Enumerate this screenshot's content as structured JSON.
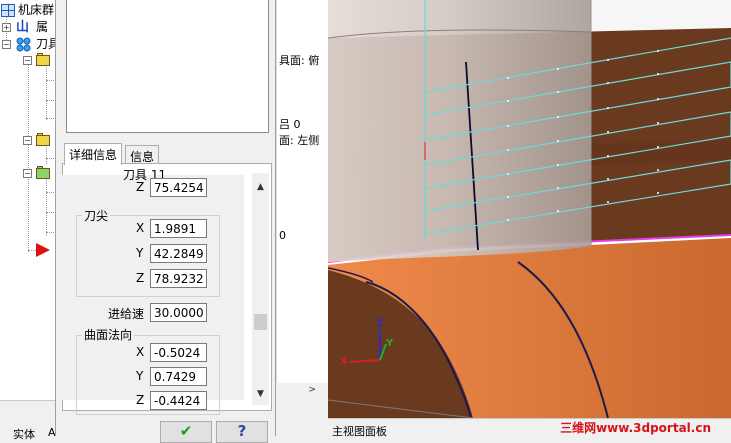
{
  "tree": {
    "items": [
      {
        "label": "机床群"
      },
      {
        "label": "属"
      },
      {
        "label": "刀具"
      }
    ]
  },
  "bottom_tabs": [
    "实体",
    "A"
  ],
  "mid_panel": {
    "lines": [
      "具面: 俯",
      "吕 0",
      "面: 左侧",
      "0"
    ]
  },
  "dialog": {
    "tabs": [
      "详细信息",
      "信息"
    ],
    "tool_label": "刀具 11",
    "top_z_label": "Z",
    "top_z_value": "75.4254",
    "tip_group": "刀尖",
    "tip": {
      "x_label": "X",
      "x": "1.9891",
      "y_label": "Y",
      "y": "42.2849",
      "z_label": "Z",
      "z": "78.9232"
    },
    "feed_label": "进给速",
    "feed_value": "30.0000",
    "normal_group": "曲面法向",
    "normal": {
      "x_label": "X",
      "x": "-0.5024",
      "y_label": "Y",
      "y": "0.7429",
      "z_label": "Z",
      "z": "-0.4424"
    },
    "ok_icon": "check-icon",
    "help_icon": "help-icon"
  },
  "viewport": {
    "axis": {
      "z": "Z",
      "y": "Y",
      "x": "X"
    },
    "status": "主视图面板",
    "watermark": "三维网www.3dportal.cn"
  },
  "colors": {
    "part_brown": "#6a3a1e",
    "part_orange": "#d8773c",
    "toolpath": "#6fd8d8",
    "tool_body": "#cfc5c0"
  }
}
